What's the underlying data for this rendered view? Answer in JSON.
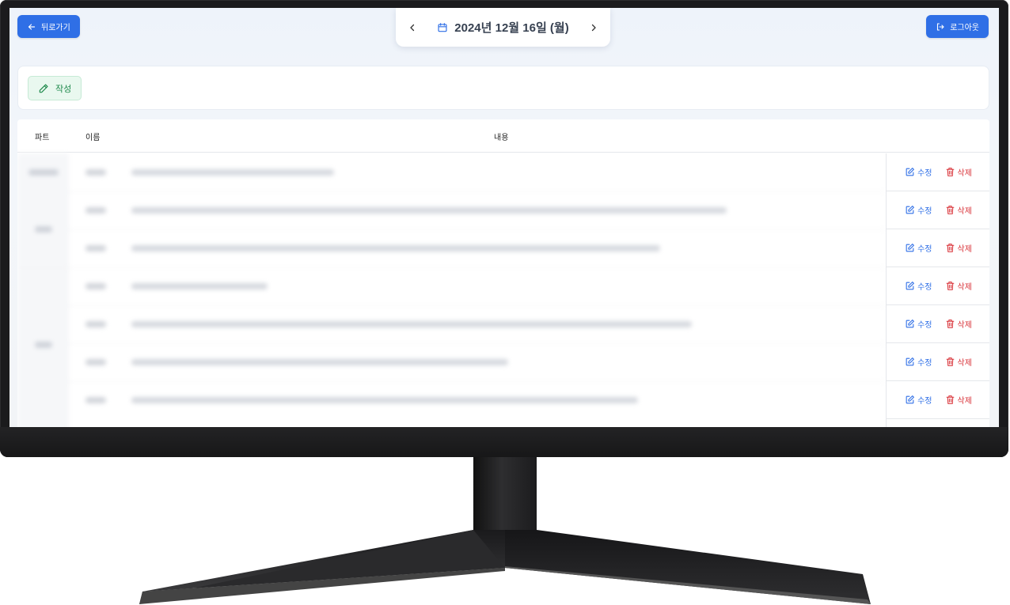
{
  "header": {
    "back_label": "뒤로가기",
    "logout_label": "로그아웃",
    "date": "2024년 12월 16일 (월)"
  },
  "toolbar": {
    "write_label": "작성"
  },
  "table": {
    "columns": [
      "파트",
      "이름",
      "내용"
    ],
    "rows": [
      {
        "edit_label": "수정",
        "delete_label": "삭제"
      },
      {
        "edit_label": "수정",
        "delete_label": "삭제"
      },
      {
        "edit_label": "수정",
        "delete_label": "삭제"
      },
      {
        "edit_label": "수정",
        "delete_label": "삭제"
      },
      {
        "edit_label": "수정",
        "delete_label": "삭제"
      },
      {
        "edit_label": "수정",
        "delete_label": "삭제"
      },
      {
        "edit_label": "수정",
        "delete_label": "삭제"
      }
    ]
  },
  "colors": {
    "primary": "#2f6fe6",
    "danger": "#d9343a",
    "success": "#1f8a4c"
  },
  "icons": [
    "arrow-left-icon",
    "chevron-left-icon",
    "calendar-icon",
    "chevron-right-icon",
    "logout-icon",
    "pencil-icon",
    "edit-icon",
    "trash-icon"
  ]
}
